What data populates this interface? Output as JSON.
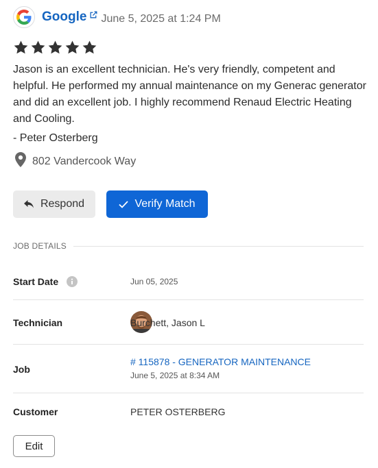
{
  "review": {
    "source_name": "Google",
    "date": "June 5, 2025 at 1:24 PM",
    "rating": 5,
    "rating_max": 5,
    "text": "Jason is an excellent technician. He's very friendly, competent and helpful. He performed my annual maintenance on my Generac generator and did an excellent job. I highly recommend Renaud Electric Heating and Cooling.",
    "reviewer": "- Peter Osterberg",
    "location": "802 Vandercook Way"
  },
  "actions": {
    "respond_label": "Respond",
    "verify_label": "Verify Match"
  },
  "job_details": {
    "section_title": "JOB DETAILS",
    "start_date_label": "Start Date",
    "start_date_value": "Jun 05, 2025",
    "technician_label": "Technician",
    "technician_value": "Burchett, Jason L",
    "job_label": "Job",
    "job_link": "# 115878 - GENERATOR MAINTENANCE",
    "job_time": "June 5, 2025 at 8:34 AM",
    "customer_label": "Customer",
    "customer_value": "PETER OSTERBERG",
    "edit_label": "Edit"
  },
  "icons": {
    "source_logo": "google-g-logo",
    "external_link": "external-link-icon",
    "star": "star-icon",
    "location": "map-pin-icon",
    "respond": "reply-arrow-icon",
    "verify": "checkmark-icon",
    "info": "info-circle-icon",
    "avatar": "technician-avatar"
  },
  "colors": {
    "primary_blue": "#0f66d6",
    "link_blue": "#1565c0",
    "star": "#333333",
    "secondary_button": "#ebebeb"
  }
}
